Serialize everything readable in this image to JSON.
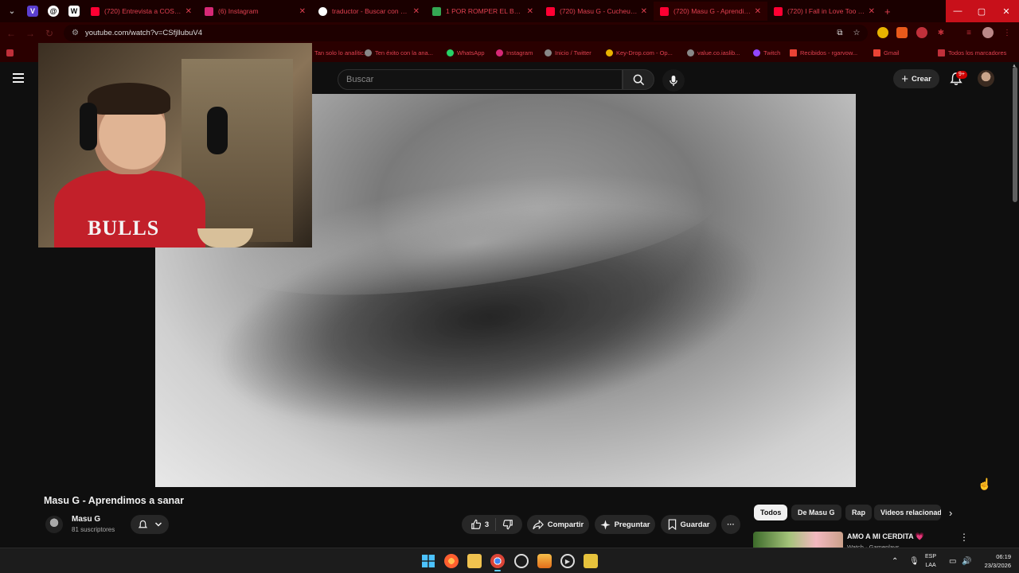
{
  "browser": {
    "tabs": [
      {
        "title": "(720) Entrevista a COSCU",
        "favicon_color": "#ff0033"
      },
      {
        "title": "(6) Instagram",
        "favicon_color": "#d62976"
      },
      {
        "title": "traductor - Buscar con Goo",
        "favicon_color": "#4285f4"
      },
      {
        "title": "1 POR ROMPER EL BEAT - C",
        "favicon_color": "#34a853"
      },
      {
        "title": "(720) Masu G - Cucheu (Vi",
        "favicon_color": "#ff0033"
      },
      {
        "title": "(720) Masu G - Aprendimos",
        "favicon_color": "#ff0033"
      },
      {
        "title": "(720) I Fall in Love Too Eas",
        "favicon_color": "#ff0033"
      }
    ],
    "url": "youtube.com/watch?v=CSfjllubuV4",
    "bookmarks": [
      "Tan solo lo analític...",
      "Ten éxito con la ana...",
      "WhatsApp",
      "Instagram",
      "Inicio / Twitter",
      "Key-Drop.com - Op...",
      "value.co.iaslib...",
      "Twitch",
      "Recibidos - rgarvow...",
      "Gmail",
      "Todos los marcadores"
    ]
  },
  "youtube": {
    "search_placeholder": "Buscar",
    "create_label": "Crear",
    "notifications_badge": "9+",
    "video_title": "Masu G - Aprendimos a sanar",
    "channel_name": "Masu G",
    "subscribers": "81 suscriptores",
    "like_count": "3",
    "share_label": "Compartir",
    "ask_label": "Preguntar",
    "save_label": "Guardar",
    "more_label": "···",
    "chips": [
      "Todos",
      "De Masu G",
      "Rap",
      "Videos relacionados"
    ],
    "recommendation": {
      "title": "AMO A MI CERDITA",
      "heart": "💗",
      "channel": "Watch · Gameplays"
    }
  },
  "webcam": {
    "shirt_text": "BULLS"
  },
  "taskbar": {
    "lang_line1": "ESP",
    "lang_line2": "LAA",
    "time": "06:19",
    "date": "23/3/2026"
  },
  "colors": {
    "accent": "#ff0033",
    "bg": "#0f0f0f",
    "chip_active": "#f1f1f1"
  }
}
